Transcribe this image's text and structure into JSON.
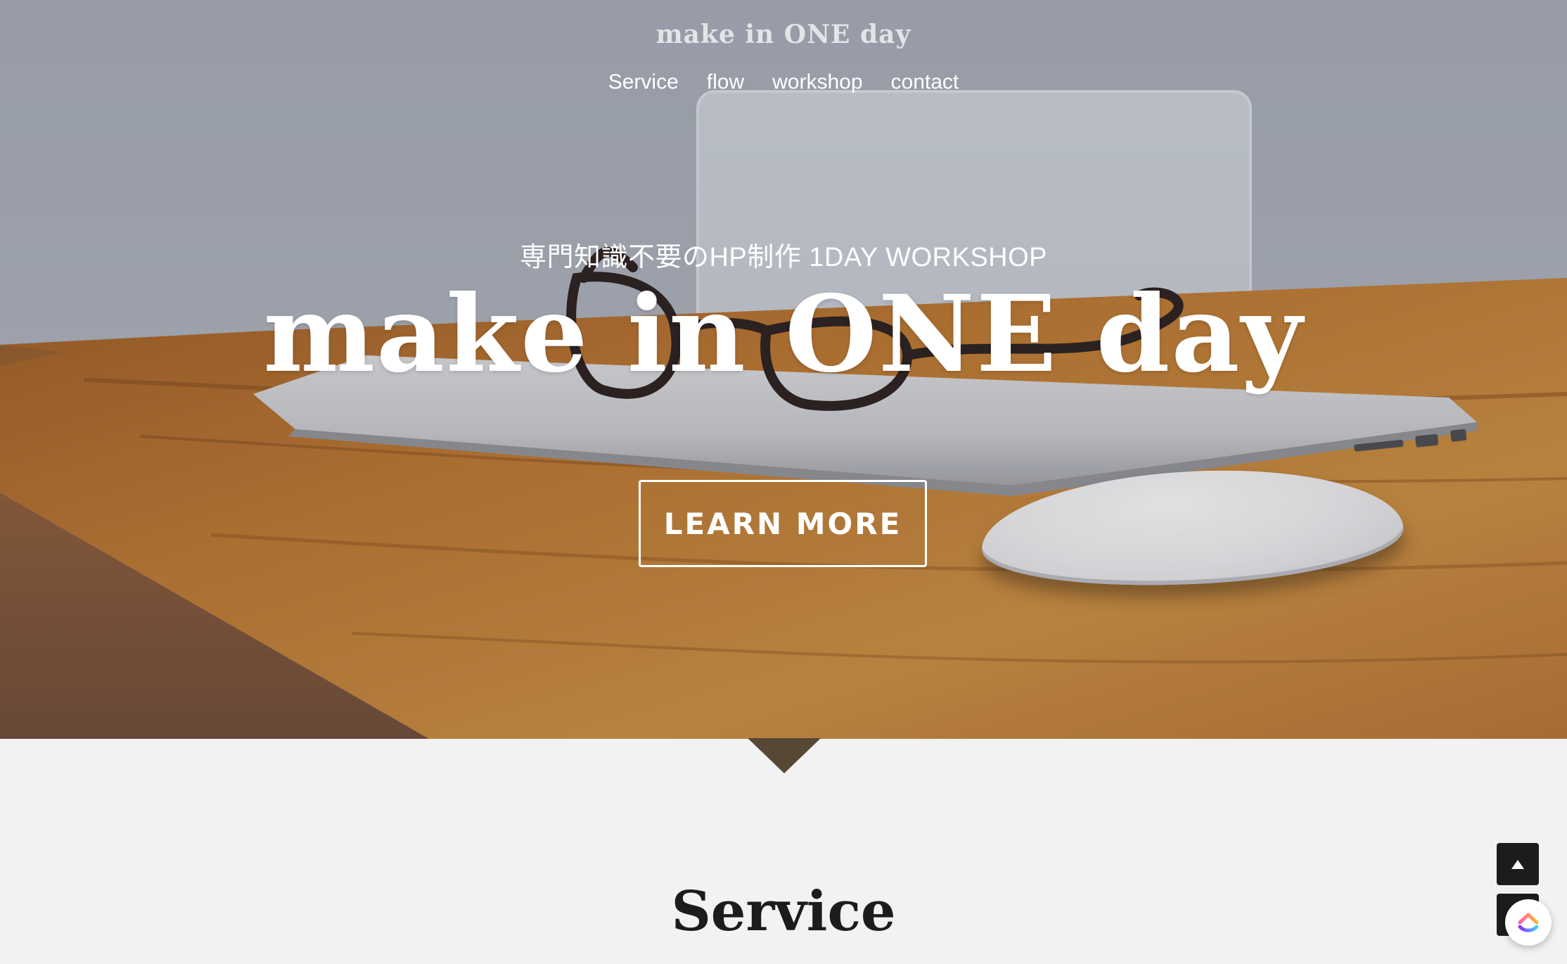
{
  "header": {
    "brand": "make in ONE day",
    "nav": [
      {
        "label": "Service"
      },
      {
        "label": "flow"
      },
      {
        "label": "workshop"
      },
      {
        "label": "contact"
      }
    ]
  },
  "hero": {
    "tagline": "専門知識不要のHP制作 1DAY WORKSHOP",
    "title": "make in ONE day",
    "cta_label": "LEARN MORE"
  },
  "service": {
    "title": "Service"
  },
  "floating": {
    "scroll_top_icon": "arrow-up-icon",
    "clickup_icon": "clickup-logo-icon"
  },
  "colors": {
    "section_background": "#f2f2f2",
    "title_dark": "#1c1c1c",
    "button_dark": "#1c1c1c",
    "hero_text": "#ffffff"
  }
}
